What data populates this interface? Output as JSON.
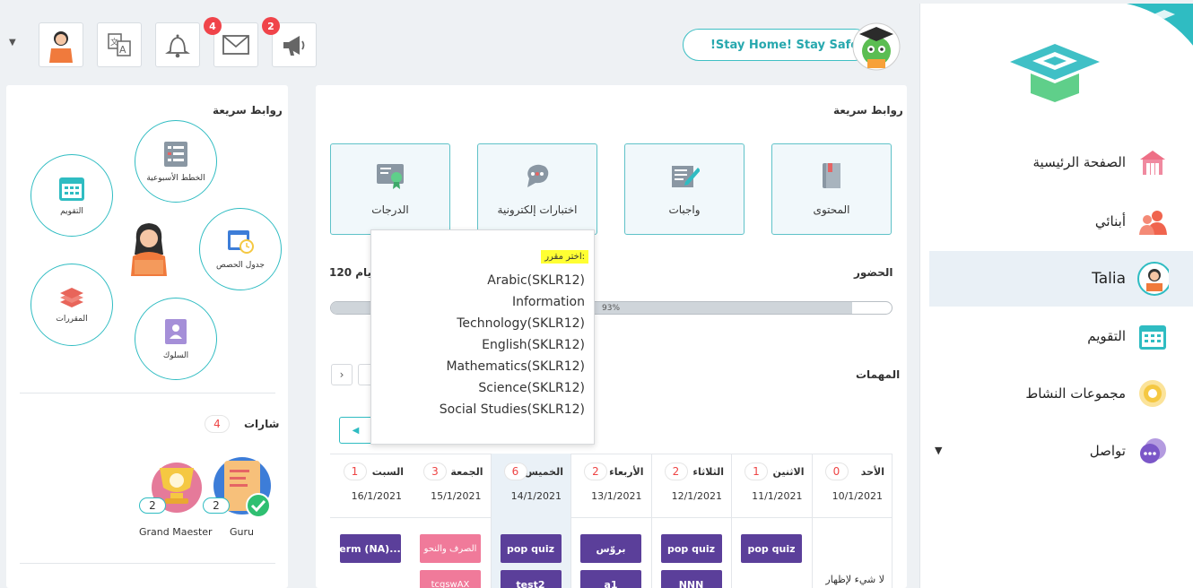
{
  "header": {
    "stay_home": "!Stay Home! Stay Safe",
    "messages_count": "4",
    "announcements_count": "2"
  },
  "sidebar": {
    "items": [
      {
        "label": "الصفحة الرئيسية",
        "icon": "school-building-icon"
      },
      {
        "label": "أبنائي",
        "icon": "children-icon"
      },
      {
        "label": "Talia",
        "icon": "student-avatar-icon"
      },
      {
        "label": "التقويم",
        "icon": "calendar-icon"
      },
      {
        "label": "مجموعات النشاط",
        "icon": "activity-target-icon"
      },
      {
        "label": "تواصل",
        "icon": "chat-icon"
      }
    ]
  },
  "main": {
    "quick_links_title": "روابط سريعة",
    "tiles": [
      {
        "label": "المحتوى",
        "icon": "book-icon"
      },
      {
        "label": "واجبات",
        "icon": "homework-icon"
      },
      {
        "label": "اختبارات إلكترونية",
        "icon": "quiz-bubble-icon"
      },
      {
        "label": "الدرجات",
        "icon": "certificate-icon"
      }
    ],
    "attendance_label": "الحضور",
    "attendance_days": "120 أيام",
    "attendance_percent": "93%",
    "attendance_fraction": 0.93,
    "tasks_label": "المهمات",
    "days": [
      {
        "name": "الأحد",
        "count": "0",
        "date": "10/1/2021",
        "chips": [],
        "empty": "لا شيء لإظهار"
      },
      {
        "name": "الاثنين",
        "count": "1",
        "date": "11/1/2021",
        "chips": [
          "pop quiz"
        ]
      },
      {
        "name": "الثلاثاء",
        "count": "2",
        "date": "12/1/2021",
        "chips": [
          "pop quiz",
          "NNN"
        ]
      },
      {
        "name": "الأربعاء",
        "count": "2",
        "date": "13/1/2021",
        "chips": [
          "بروّس",
          "a1"
        ]
      },
      {
        "name": "الخميس",
        "count": "6",
        "date": "14/1/2021",
        "chips": [
          "pop quiz",
          "test2"
        ]
      },
      {
        "name": "الجمعة",
        "count": "3",
        "date": "15/1/2021",
        "chips": [
          "الصرف والنحو",
          "tcgswAX"
        ]
      },
      {
        "name": "السبت",
        "count": "1",
        "date": "16/1/2021",
        "chips": [
          "erm (NA)..."
        ]
      }
    ]
  },
  "dropdown": {
    "title": "اختر مقرر:",
    "options": [
      "Arabic(SKLR12)",
      "Information",
      "Technology(SKLR12)",
      "English(SKLR12)",
      "Mathematics(SKLR12)",
      "Science(SKLR12)",
      "Social Studies(SKLR12)"
    ]
  },
  "left_panel": {
    "quick_links_title": "روابط سريعة",
    "circles": [
      {
        "label": "الخطط الأسبوعية",
        "icon": "weekly-plan-icon"
      },
      {
        "label": "التقويم",
        "icon": "calendar-icon"
      },
      {
        "label": "جدول الحصص",
        "icon": "timetable-icon"
      },
      {
        "label": "المقررات",
        "icon": "courses-books-icon"
      },
      {
        "label": "السلوك",
        "icon": "behavior-icon"
      }
    ],
    "badges_title": "شارات",
    "badges_count": "4",
    "badges": [
      {
        "name": "Guru",
        "count": "2"
      },
      {
        "name": "Grand Maester",
        "count": "2"
      }
    ]
  },
  "colors": {
    "teal": "#2fbcc2",
    "purple_chip": "#5b3f9a",
    "pink_chip": "#f07a9a",
    "badge_red": "#f0444a"
  }
}
